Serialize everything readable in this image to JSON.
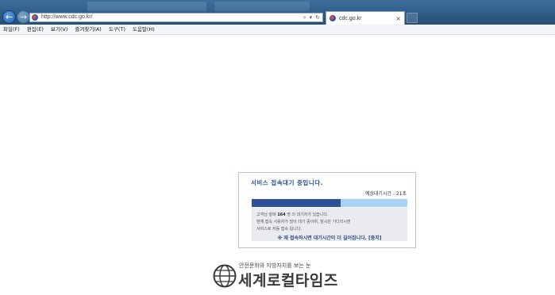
{
  "browser": {
    "url": "http://www.cdc.go.kr/",
    "tab_title": "cdc.go.kr",
    "tab_close": "×",
    "back_glyph": "←",
    "forward_glyph": "→",
    "search_glyph": "⌕",
    "dropdown_glyph": "▾",
    "refresh_glyph": "↻",
    "icons": {
      "back": "back-arrow-icon",
      "forward": "forward-arrow-icon",
      "site": "site-favicon-icon",
      "search": "search-icon",
      "refresh": "refresh-icon",
      "close": "close-icon"
    }
  },
  "menu": {
    "items": [
      {
        "label": "파일(F)"
      },
      {
        "label": "편집(E)"
      },
      {
        "label": "보기(V)"
      },
      {
        "label": "즐겨찾기(A)"
      },
      {
        "label": "도구(T)"
      },
      {
        "label": "도움말(H)"
      }
    ]
  },
  "wait_popup": {
    "title": "서비스 접속대기 중입니다.",
    "eta_label": "예상대기시간 : 21초",
    "progress_fraction": 0.57,
    "notice_line1_prefix": "고객님 앞에 ",
    "notice_line1_count": "164",
    "notice_line1_suffix": " 명 의 대기자가 있습니다.",
    "notice_line2": "현재 접속 사용자가 많아 대기 중이며, 잠시만 기다리시면",
    "notice_line3": "서비스로 자동 접속 됩니다.",
    "stop_notice": "※ 재 접속하시면 대기시간이 더 길어집니다. [중지]",
    "colors": {
      "accent": "#2b4f8c",
      "progress_fill": "#2f4f99",
      "progress_track": "#a7d2f5",
      "notice_bg": "#e9ebee"
    }
  },
  "logo": {
    "tagline": "안전문화와 지방자치를 보는 눈",
    "name": "세계로컬타임즈",
    "emblem_icon": "globe-emblem-icon"
  }
}
